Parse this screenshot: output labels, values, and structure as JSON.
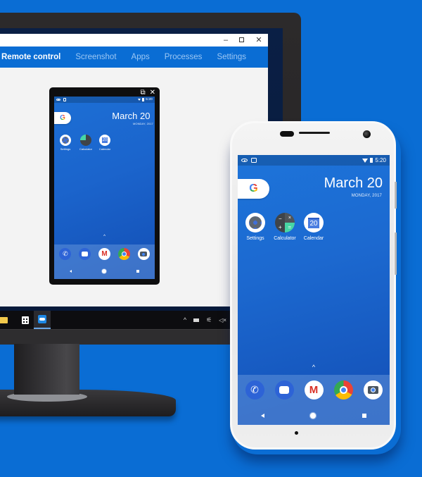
{
  "app_window": {
    "controls": {
      "minimize": "–",
      "close": "✕"
    },
    "tabs": [
      {
        "label": "Remote control",
        "active": true
      },
      {
        "label": "Screenshot",
        "active": false
      },
      {
        "label": "Apps",
        "active": false
      },
      {
        "label": "Processes",
        "active": false
      },
      {
        "label": "Settings",
        "active": false
      }
    ],
    "mirror_toolbar": {
      "popout_icon": "⧉",
      "close_icon": "✕"
    }
  },
  "taskbar": {
    "pinned": [
      {
        "name": "file-explorer-icon"
      },
      {
        "name": "store-icon"
      },
      {
        "name": "teamviewer-icon",
        "active": true
      }
    ],
    "tray": {
      "chevron": "^",
      "network": "⚟",
      "volume": "🔇"
    }
  },
  "android": {
    "status_bar": {
      "time": "5:20"
    },
    "search_widget": {
      "letter": "G"
    },
    "date": {
      "day": "March 20",
      "weekday_year": "MONDAY, 2017"
    },
    "home_apps": [
      {
        "label": "Settings",
        "icon": "settings-icon"
      },
      {
        "label": "Calculator",
        "icon": "calculator-icon"
      },
      {
        "label": "Calendar",
        "icon": "calendar-icon",
        "glyph": "20"
      }
    ],
    "drawer_chevron": "^",
    "dock": [
      {
        "name": "phone",
        "icon": "phone-icon"
      },
      {
        "name": "messages",
        "icon": "messages-icon"
      },
      {
        "name": "gmail",
        "icon": "gmail-icon",
        "glyph": "M"
      },
      {
        "name": "chrome",
        "icon": "chrome-icon"
      },
      {
        "name": "camera",
        "icon": "camera-icon"
      }
    ]
  },
  "colors": {
    "background": "#0a6dd4",
    "accent_blue": "#0a6dd4",
    "inactive_tab": "#9cc7f4",
    "taskbar": "#0d0d10"
  }
}
